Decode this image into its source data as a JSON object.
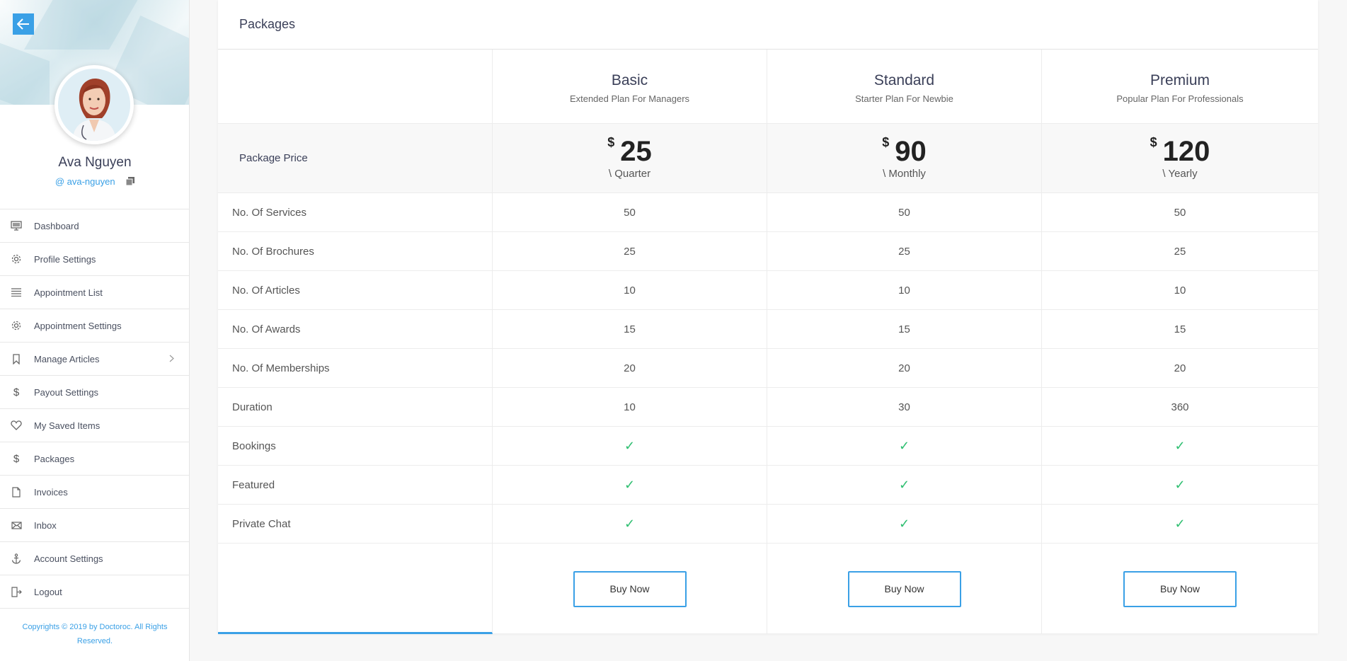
{
  "sidebar": {
    "user_name": "Ava Nguyen",
    "user_handle": "@ ava-nguyen",
    "items": [
      {
        "label": "Dashboard",
        "icon": "monitor-icon"
      },
      {
        "label": "Profile Settings",
        "icon": "gear-icon"
      },
      {
        "label": "Appointment List",
        "icon": "list-icon"
      },
      {
        "label": "Appointment Settings",
        "icon": "gear-icon"
      },
      {
        "label": "Manage Articles",
        "icon": "bookmark-icon"
      },
      {
        "label": "Payout Settings",
        "icon": "dollar-icon"
      },
      {
        "label": "My Saved Items",
        "icon": "heart-icon"
      },
      {
        "label": "Packages",
        "icon": "dollar-icon"
      },
      {
        "label": "Invoices",
        "icon": "document-icon"
      },
      {
        "label": "Inbox",
        "icon": "envelope-icon"
      },
      {
        "label": "Account Settings",
        "icon": "anchor-icon"
      },
      {
        "label": "Logout",
        "icon": "logout-icon"
      }
    ],
    "copyright": "Copyrights © 2019 by Doctoroc. All Rights Reserved."
  },
  "main": {
    "title": "Packages",
    "price_label": "Package Price",
    "plans": [
      {
        "name": "Basic",
        "subtitle": "Extended Plan For Managers",
        "currency": "$",
        "price": "25",
        "period": "\\ Quarter",
        "button": "Buy Now"
      },
      {
        "name": "Standard",
        "subtitle": "Starter Plan For Newbie",
        "currency": "$",
        "price": "90",
        "period": "\\ Monthly",
        "button": "Buy Now"
      },
      {
        "name": "Premium",
        "subtitle": "Popular Plan For Professionals",
        "currency": "$",
        "price": "120",
        "period": "\\ Yearly",
        "button": "Buy Now"
      }
    ],
    "features": [
      {
        "label": "No. Of Services",
        "values": [
          "50",
          "50",
          "50"
        ]
      },
      {
        "label": "No. Of Brochures",
        "values": [
          "25",
          "25",
          "25"
        ]
      },
      {
        "label": "No. Of Articles",
        "values": [
          "10",
          "10",
          "10"
        ]
      },
      {
        "label": "No. Of Awards",
        "values": [
          "15",
          "15",
          "15"
        ]
      },
      {
        "label": "No. Of Memberships",
        "values": [
          "20",
          "20",
          "20"
        ]
      },
      {
        "label": "Duration",
        "values": [
          "10",
          "30",
          "360"
        ]
      },
      {
        "label": "Bookings",
        "values": [
          "✓",
          "✓",
          "✓"
        ]
      },
      {
        "label": "Featured",
        "values": [
          "✓",
          "✓",
          "✓"
        ]
      },
      {
        "label": "Private Chat",
        "values": [
          "✓",
          "✓",
          "✓"
        ]
      }
    ]
  },
  "colors": {
    "accent": "#3aa0e6",
    "check": "#2fbf71"
  }
}
